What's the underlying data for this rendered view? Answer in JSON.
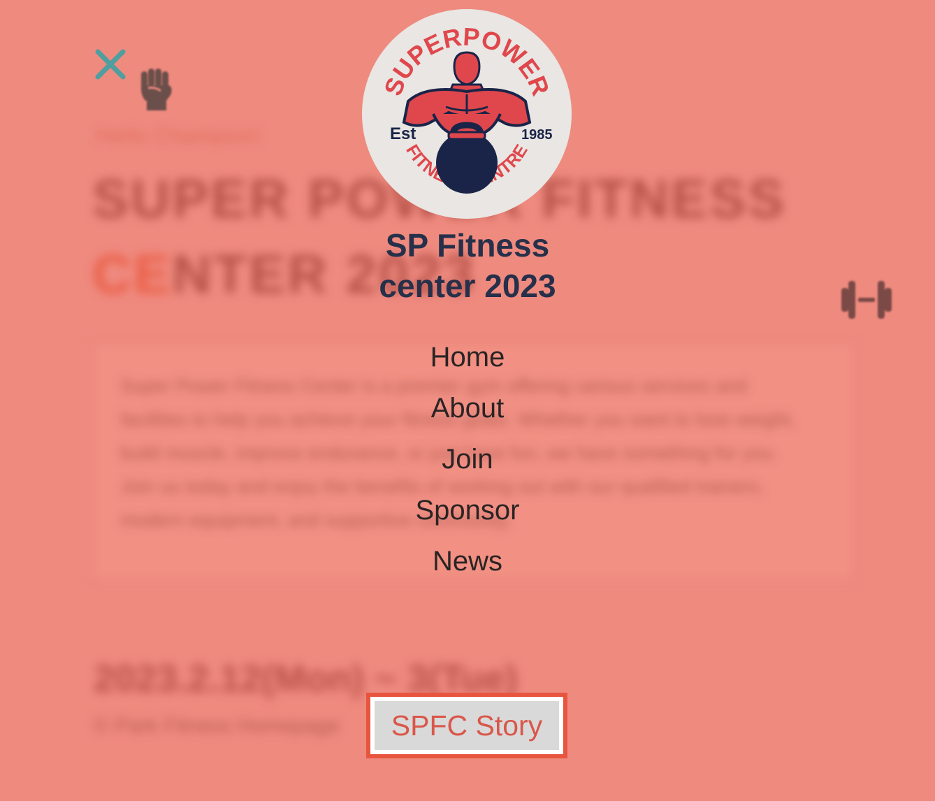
{
  "page": {
    "bg_tag": "Hello Champion!",
    "bg_title_main": "SUPER POWER FITNESS",
    "bg_title_accent": "CE",
    "bg_title_rest": "NTER 2023",
    "bg_paragraph": "Super Power Fitness Center is a premier gym offering various services and facilities to help you achieve your fitness goals. Whether you want to lose weight, build muscle, improve endurance, or just have fun, we have something for you. Join us today and enjoy the benefits of working out with our qualified trainers, modern equipment, and supportive community.",
    "bg_date": "2023.2.12(Mon) ~ 3(Tue)",
    "bg_copyright": "© Park Fitness Homepage"
  },
  "logo": {
    "arc_top": "SUPERPOWER",
    "arc_bottom": "FITNESS CENTRE",
    "est": "Est",
    "year": "1985"
  },
  "site": {
    "title_line1": "SP Fitness",
    "title_line2": "center 2023"
  },
  "menu": {
    "items": [
      {
        "label": "Home"
      },
      {
        "label": "About"
      },
      {
        "label": "Join"
      },
      {
        "label": "Sponsor"
      },
      {
        "label": "News"
      }
    ],
    "story_button": "SPFC Story"
  },
  "icons": {
    "close": "close-icon",
    "fist": "raised-fist-icon",
    "dumbbell": "dumbbell-icon"
  },
  "colors": {
    "overlay_bg": "#ef8a7f",
    "close": "#4f9ea0",
    "title": "#26304a",
    "accent": "#e8553f",
    "logo_red": "#e0474c",
    "logo_navy": "#1a2448"
  }
}
